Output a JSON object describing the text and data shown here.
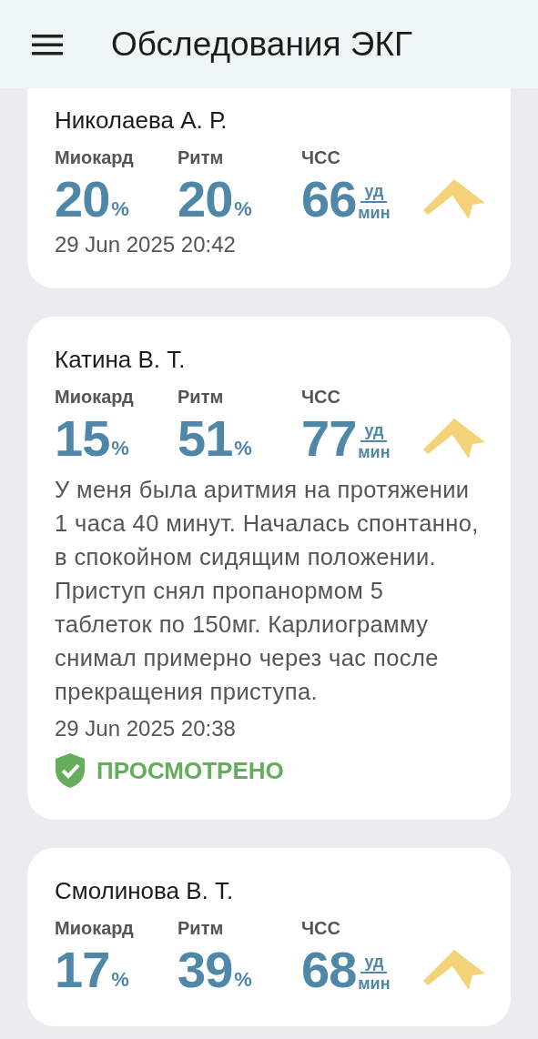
{
  "title": "Обследования ЭКГ",
  "records": [
    {
      "name": "Николаева А. Р.",
      "metrics": [
        {
          "label": "Миокард",
          "value": "20",
          "unit": "%"
        },
        {
          "label": "Ритм",
          "value": "20",
          "unit": "%"
        }
      ],
      "hr": {
        "label": "ЧСС",
        "value": "66",
        "unit_top": "уд",
        "unit_bottom": "мин"
      },
      "date": "29 Jun 2025 20:42"
    },
    {
      "name": "Катина В. Т.",
      "metrics": [
        {
          "label": "Миокард",
          "value": "15",
          "unit": "%"
        },
        {
          "label": "Ритм",
          "value": "51",
          "unit": "%"
        }
      ],
      "hr": {
        "label": "ЧСС",
        "value": "77",
        "unit_top": "уд",
        "unit_bottom": "мин"
      },
      "comment": "У меня была аритмия на протяжении 1 часа 40 минут. Началась спонтанно, в спокойном сидящим положении. Приступ снял пропанормом 5 таблеток по 150мг. Карлиограмму снимал примерно через час после прекращения приступа.",
      "date": "29 Jun 2025 20:38",
      "status": "ПРОСМОТРЕНО"
    },
    {
      "name": "Смолинова В. Т.",
      "metrics": [
        {
          "label": "Миокард",
          "value": "17",
          "unit": "%"
        },
        {
          "label": "Ритм",
          "value": "39",
          "unit": "%"
        }
      ],
      "hr": {
        "label": "ЧСС",
        "value": "68",
        "unit_top": "уд",
        "unit_bottom": "мин"
      }
    }
  ]
}
